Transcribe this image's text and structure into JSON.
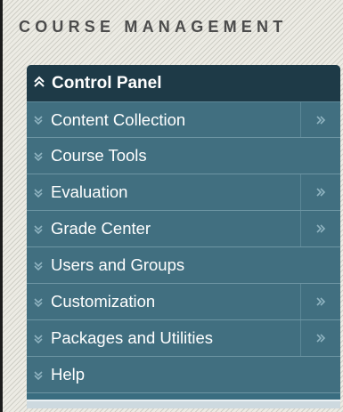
{
  "header": {
    "title": "COURSE MANAGEMENT"
  },
  "control_panel": {
    "title": "Control Panel",
    "expanded": true,
    "items": [
      {
        "label": "Content Collection",
        "has_open_button": true
      },
      {
        "label": "Course Tools",
        "has_open_button": false
      },
      {
        "label": "Evaluation",
        "has_open_button": true
      },
      {
        "label": "Grade Center",
        "has_open_button": true
      },
      {
        "label": "Users and Groups",
        "has_open_button": false
      },
      {
        "label": "Customization",
        "has_open_button": true
      },
      {
        "label": "Packages and Utilities",
        "has_open_button": true
      },
      {
        "label": "Help",
        "has_open_button": false
      }
    ]
  },
  "icons": {
    "collapse": "chevron-double-up-icon",
    "expand": "chevron-double-down-icon",
    "open": "chevron-double-right-icon"
  },
  "colors": {
    "page_background": "#ecebe4",
    "header_text": "#4c4c4c",
    "panel_header": "#1e3a47",
    "panel_item": "#416f80",
    "item_divider": "#6d95a3",
    "item_text": "#ffffff",
    "chevron": "#8fb3c0"
  }
}
